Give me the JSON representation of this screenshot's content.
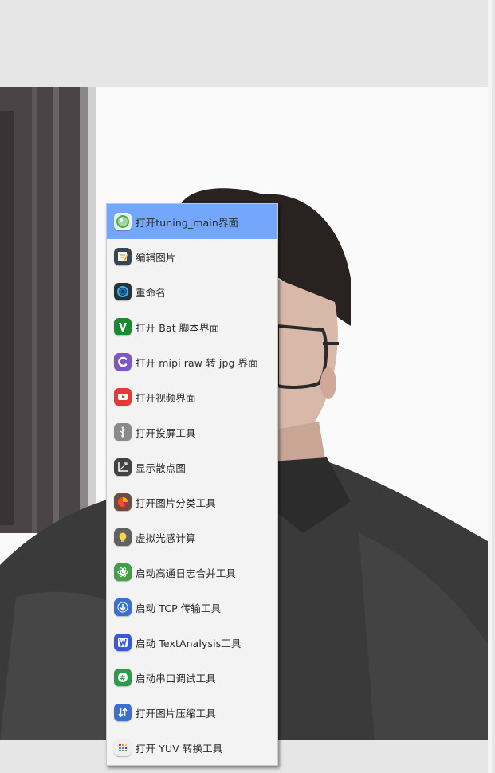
{
  "context_menu": {
    "items": [
      {
        "label": "打开tuning_main界面",
        "icon": "green-bubble-icon",
        "active": true,
        "color": "#4caf50"
      },
      {
        "label": "编辑图片",
        "icon": "notepad-edit-icon",
        "active": false,
        "color": "#37474f"
      },
      {
        "label": "重命名",
        "icon": "swirl-icon",
        "active": false,
        "color": "#263238"
      },
      {
        "label": "打开 Bat 脚本界面",
        "icon": "vim-v-icon",
        "active": false,
        "color": "#1b8a2c"
      },
      {
        "label": "打开 mipi raw 转 jpg 界面",
        "icon": "letter-c-icon",
        "active": false,
        "color": "#7e57c2"
      },
      {
        "label": "打开视频界面",
        "icon": "video-play-icon",
        "active": false,
        "color": "#e53935"
      },
      {
        "label": "打开投屏工具",
        "icon": "usb-icon",
        "active": false,
        "color": "#8a8a8a"
      },
      {
        "label": "显示散点图",
        "icon": "scatter-axes-icon",
        "active": false,
        "color": "#424242"
      },
      {
        "label": "打开图片分类工具",
        "icon": "pie-chart-icon",
        "active": false,
        "color": "#f4511e"
      },
      {
        "label": "虚拟光感计算",
        "icon": "light-bulb-icon",
        "active": false,
        "color": "#616161"
      },
      {
        "label": "启动高通日志合并工具",
        "icon": "atom-icon",
        "active": false,
        "color": "#43a047"
      },
      {
        "label": "启动 TCP 传输工具",
        "icon": "download-arrow-icon",
        "active": false,
        "color": "#3b6fd1"
      },
      {
        "label": "启动 TextAnalysis工具",
        "icon": "letter-w-icon",
        "active": false,
        "color": "#3a5bd9"
      },
      {
        "label": "启动串口调试工具",
        "icon": "hash-chat-icon",
        "active": false,
        "color": "#2e9a4e"
      },
      {
        "label": "打开图片压缩工具",
        "icon": "swap-arrows-icon",
        "active": false,
        "color": "#3b6fd1"
      },
      {
        "label": "打开 YUV 转换工具",
        "icon": "color-grid-icon",
        "active": false,
        "color": "#eeeeee"
      }
    ],
    "active_color": "#74a7fb",
    "background_color": "#f3f3f3"
  }
}
